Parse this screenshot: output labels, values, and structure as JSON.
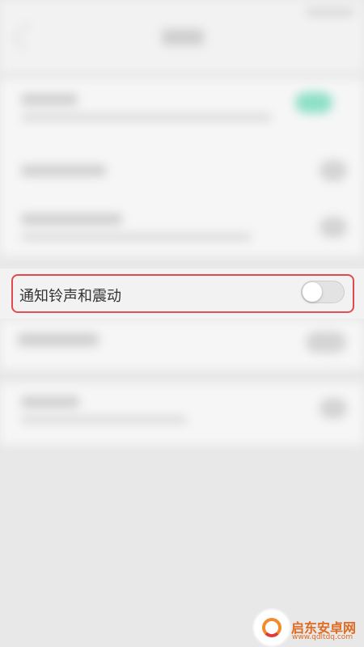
{
  "settings": {
    "notification_sound_row": {
      "label": "通知铃声和震动",
      "toggle_state": "off"
    }
  },
  "watermark": {
    "brand": "启东安卓网",
    "url": "www.qdltdq.com"
  },
  "colors": {
    "highlight_border": "#e04a4f",
    "blurred_toggle_on": "#8ee0c8"
  }
}
